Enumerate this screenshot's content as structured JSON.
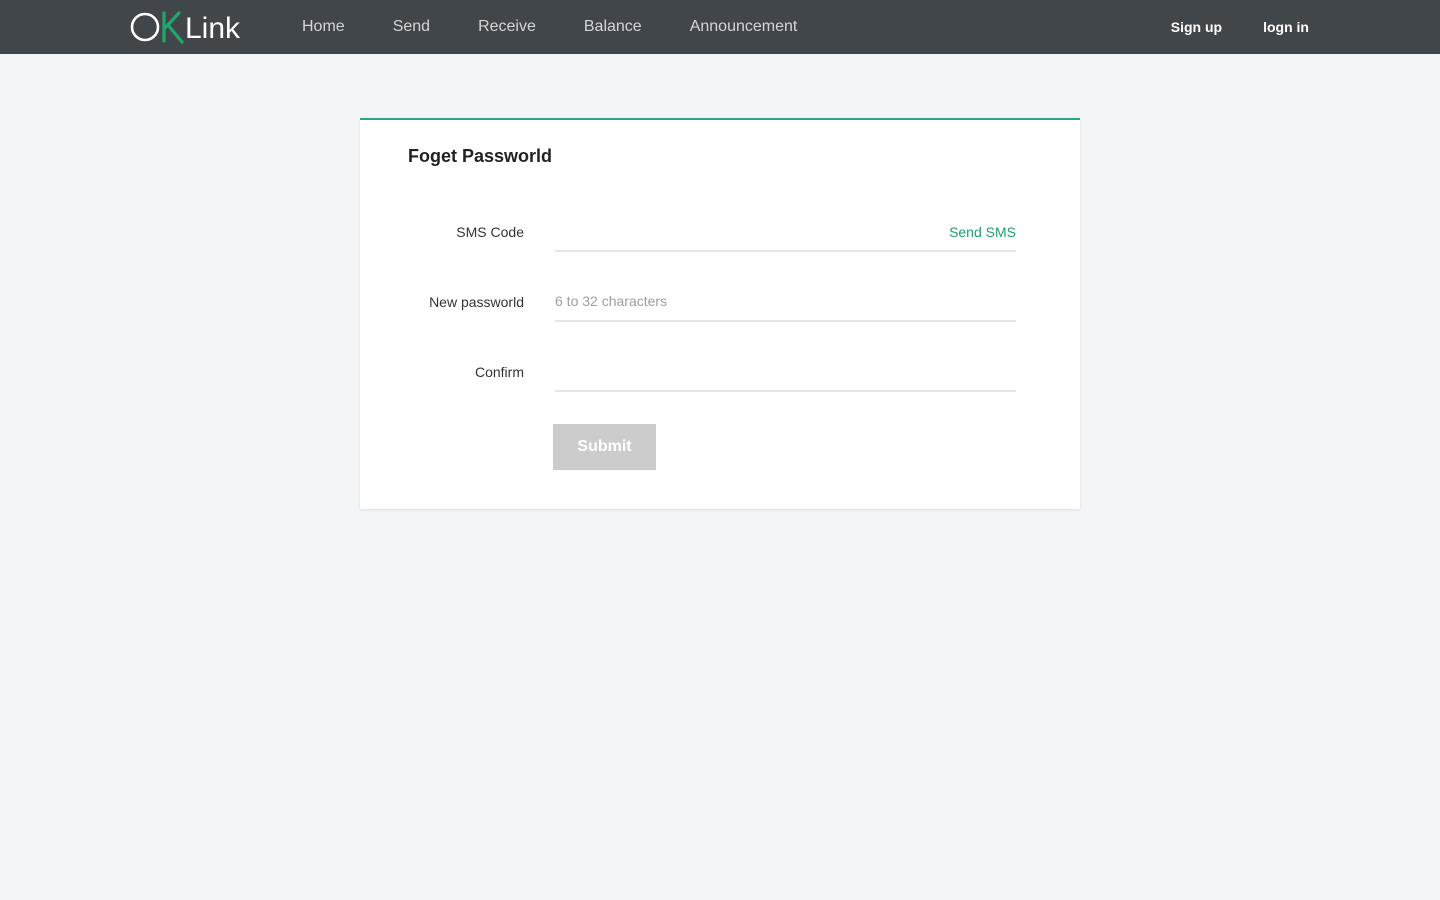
{
  "header": {
    "logo": {
      "prefix": "O",
      "accent": "K",
      "suffix": "Link",
      "accent_color": "#1fa86b"
    },
    "nav": [
      "Home",
      "Send",
      "Receive",
      "Balance",
      "Announcement"
    ],
    "auth": {
      "signup": "Sign up",
      "login": "logn in"
    }
  },
  "form": {
    "title": "Foget Passworld",
    "fields": {
      "sms_code": {
        "label": "SMS Code",
        "value": "",
        "placeholder": "",
        "action": "Send SMS"
      },
      "new_password": {
        "label": "New passworld",
        "value": "",
        "placeholder": "6 to 32 characters"
      },
      "confirm": {
        "label": "Confirm",
        "value": "",
        "placeholder": ""
      }
    },
    "submit_label": "Submit"
  },
  "colors": {
    "header_bg": "#41464b",
    "accent": "#2aa58a",
    "link_green": "#1f9e6e",
    "button_disabled": "#cccccc",
    "page_bg": "#f4f5f7"
  }
}
